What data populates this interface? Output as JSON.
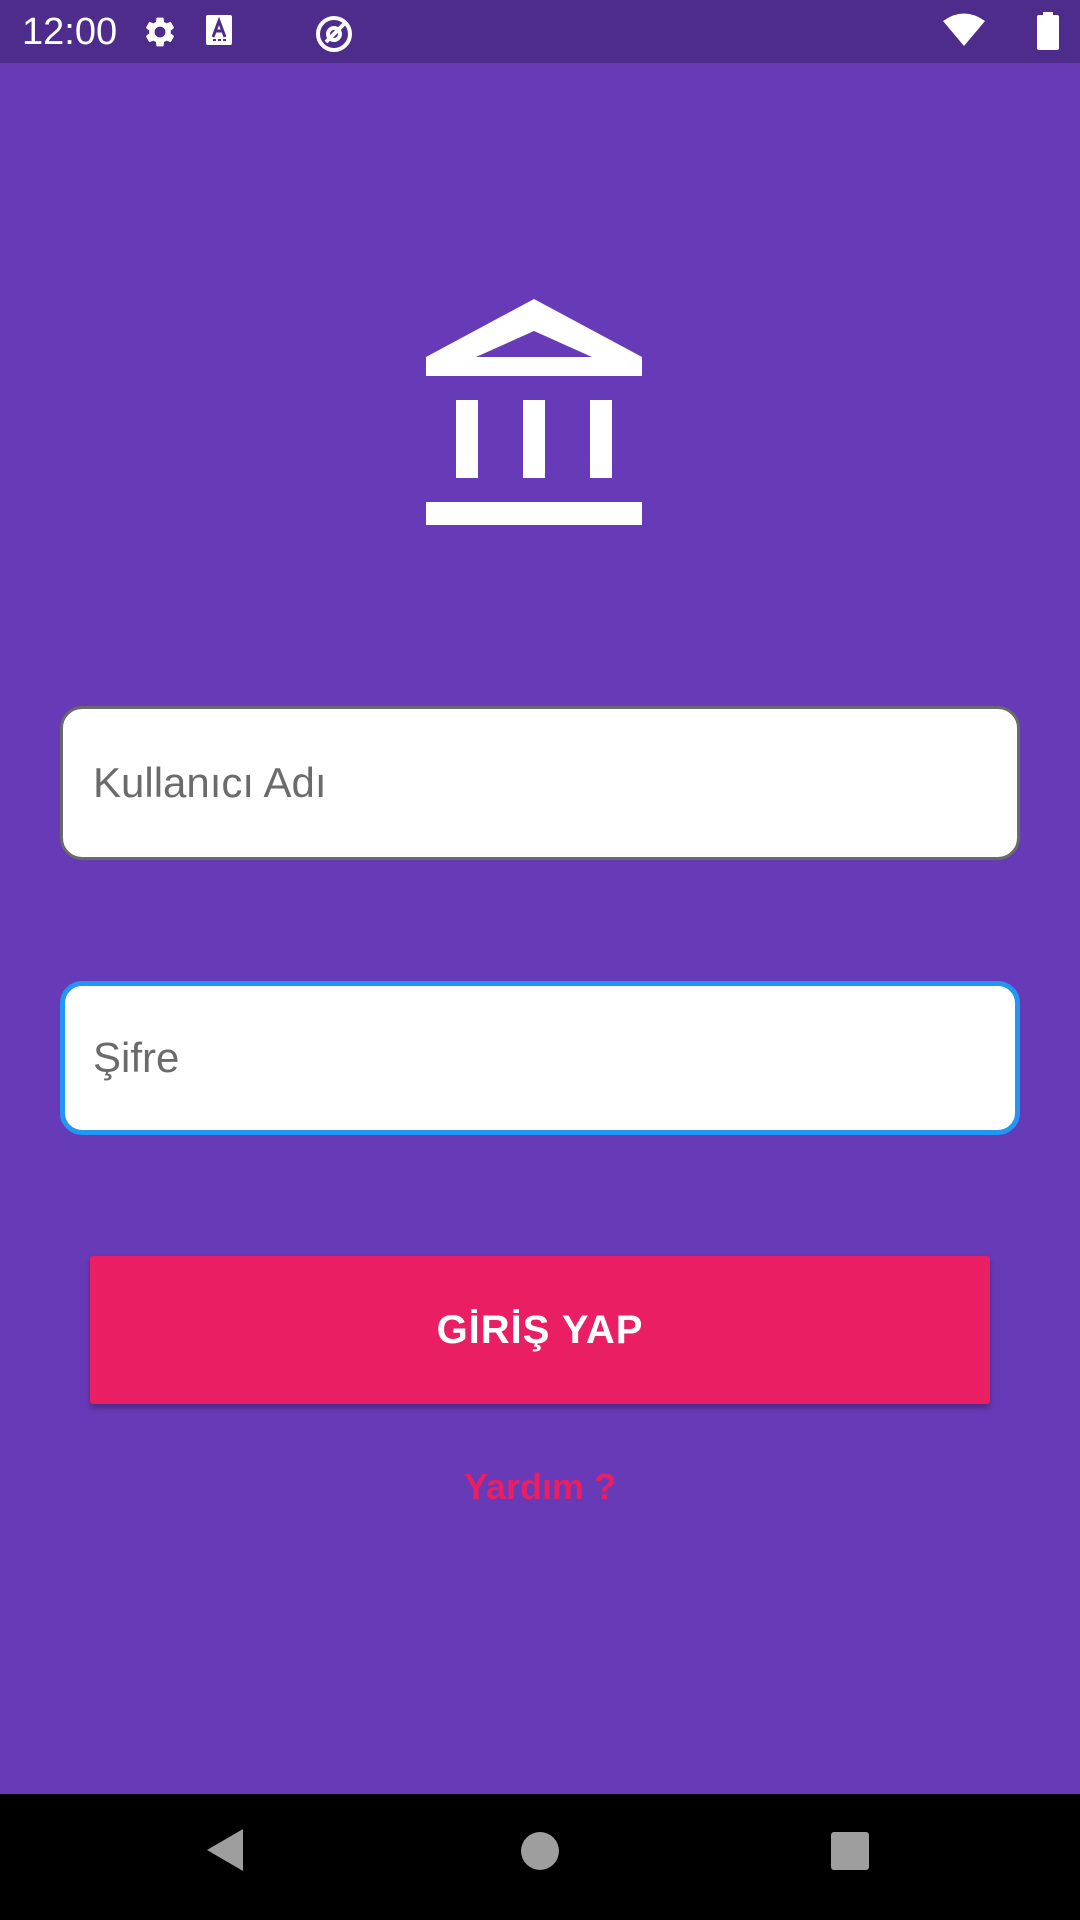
{
  "status_bar": {
    "time": "12:00",
    "icons": [
      "gear-icon",
      "text-a-icon",
      "at-sign-icon",
      "wifi-icon",
      "battery-icon"
    ],
    "background_color": "#4e2c8c"
  },
  "app": {
    "logo_icon": "bank-building-icon",
    "background_color": "#673ab7"
  },
  "login_form": {
    "username_placeholder": "Kullanıcı Adı",
    "password_placeholder": "Şifre",
    "submit_label": "GİRİŞ YAP",
    "help_link": "Yardım ?",
    "accent_color": "#e91e63",
    "focus_color": "#2196f3"
  },
  "nav_bar": {
    "buttons": [
      "back-icon",
      "home-icon",
      "recents-icon"
    ]
  }
}
